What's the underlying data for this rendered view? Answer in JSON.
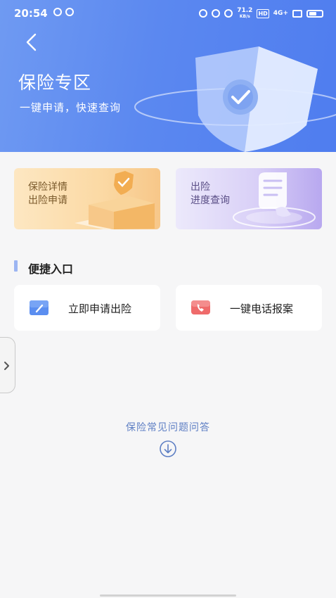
{
  "status_bar": {
    "time": "20:54",
    "network_speed": "71.2",
    "network_speed_unit": "KB/s",
    "hd_badge": "HD",
    "signal_label": "4G+"
  },
  "header": {
    "title": "保险专区",
    "subtitle": "一键申请，快速查询",
    "back_icon": "chevron-left-icon",
    "illustration_icon": "shield-check-icon"
  },
  "cards": [
    {
      "line1": "保险详情",
      "line2": "出险申请",
      "icon": "shield-box-illustration"
    },
    {
      "line1": "出险",
      "line2": "进度查询",
      "icon": "receipt-illustration"
    }
  ],
  "quick_access": {
    "section_title": "便捷入口",
    "items": [
      {
        "label": "立即申请出险",
        "icon": "edit-icon"
      },
      {
        "label": "一键电话报案",
        "icon": "phone-icon"
      }
    ]
  },
  "side_tab": {
    "icon": "chevron-right-icon"
  },
  "faq": {
    "label": "保险常见问题问答",
    "icon": "arrow-down-circle-icon"
  },
  "colors": {
    "header_start": "#6f9af2",
    "header_end": "#4f7def",
    "accent": "#5e7fc4",
    "section_bar": "#9cb5f2"
  }
}
